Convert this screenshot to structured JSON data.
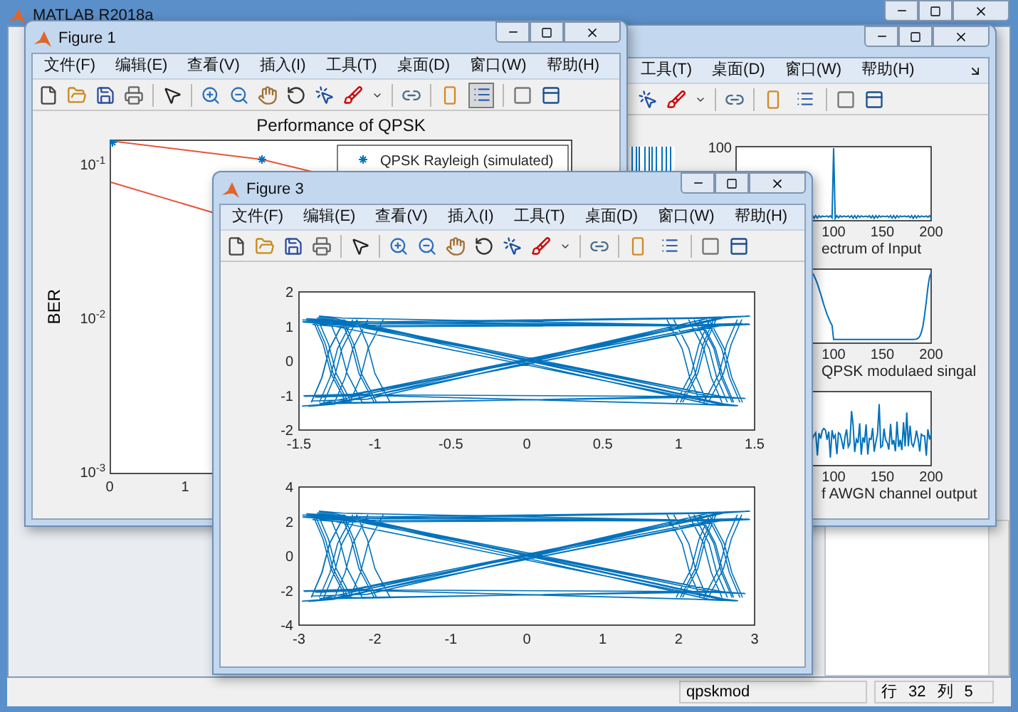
{
  "app": {
    "title": "MATLAB R2018a"
  },
  "figure_1": {
    "title": "Figure 1",
    "menu": [
      "文件(F)",
      "编辑(E)",
      "查看(V)",
      "插入(I)",
      "工具(T)",
      "桌面(D)",
      "窗口(W)",
      "帮助(H)"
    ],
    "legend_button_pressed": true,
    "plot": {
      "title": "Performance of QPSK",
      "ylabel": "BER",
      "yticks": [
        "10$^{-1}$",
        "10$^{-2}$",
        "10$^{-3}$"
      ],
      "xticks": [
        "0",
        "1"
      ],
      "legend": [
        "QPSK Rayleigh (simulated)"
      ]
    }
  },
  "figure_2": {
    "menu": [
      "工具(T)",
      "桌面(D)",
      "窗口(W)",
      "帮助(H)"
    ],
    "legend_button_pressed": false,
    "plots": [
      {
        "kind": "spectrum",
        "yticks": [
          "100"
        ],
        "xticks": [
          "100",
          "150",
          "200"
        ],
        "xlabel": "ectrum of Input"
      },
      {
        "kind": "modulated",
        "xticks": [
          "100",
          "150",
          "200"
        ],
        "xlabel": "QPSK modulaed singal"
      },
      {
        "kind": "noise",
        "xticks": [
          "100",
          "150",
          "200"
        ],
        "xlabel": "f AWGN channel output"
      }
    ]
  },
  "figure_3": {
    "title": "Figure 3",
    "menu": [
      "文件(F)",
      "编辑(E)",
      "查看(V)",
      "插入(I)",
      "工具(T)",
      "桌面(D)",
      "窗口(W)",
      "帮助(H)"
    ],
    "legend_button_pressed": false,
    "plots": [
      {
        "yticks": [
          "2",
          "1",
          "0",
          "-1",
          "-2"
        ],
        "xticks": [
          "-1.5",
          "-1",
          "-0.5",
          "0",
          "0.5",
          "1",
          "1.5"
        ]
      },
      {
        "yticks": [
          "4",
          "2",
          "0",
          "-2",
          "-4"
        ],
        "xticks": [
          "-3",
          "-2",
          "-1",
          "0",
          "1",
          "2",
          "3"
        ]
      }
    ]
  },
  "status_bar": {
    "file": "qpskmod",
    "row_label": "行",
    "row": "32",
    "col_label": "列",
    "col": "5"
  }
}
